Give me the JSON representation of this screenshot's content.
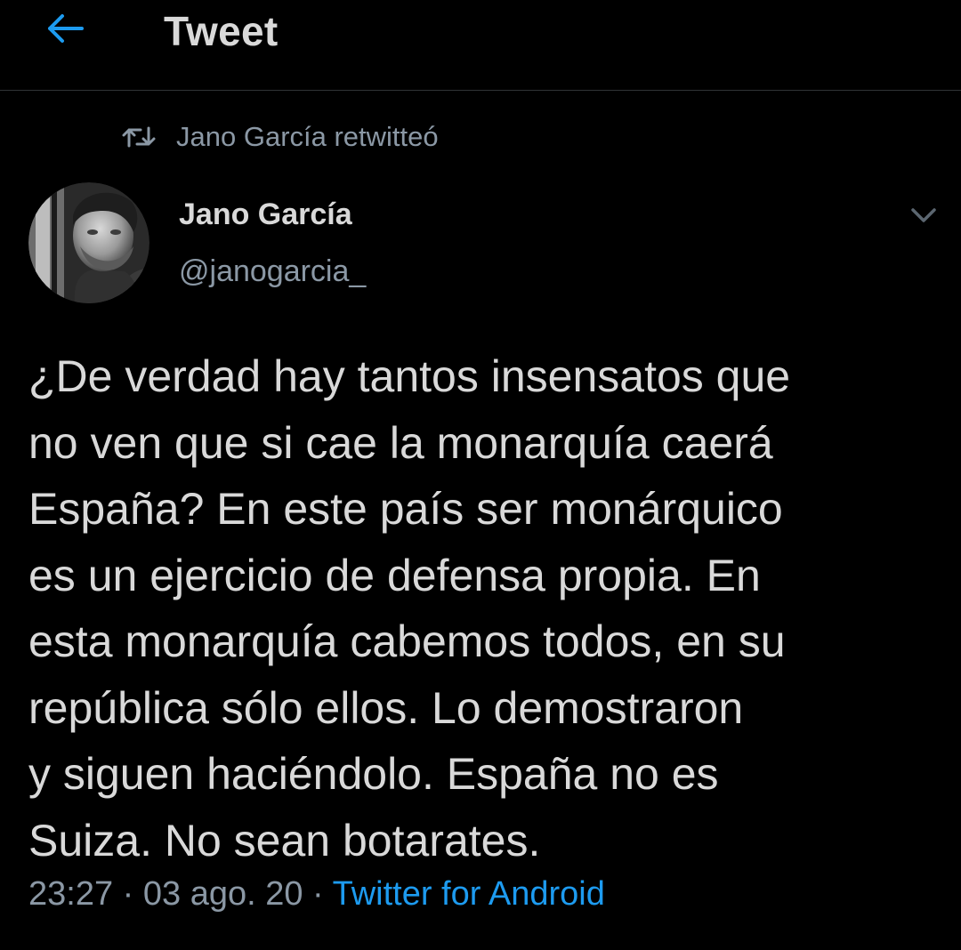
{
  "header": {
    "title": "Tweet",
    "back_icon": "arrow-left-icon",
    "accent_color": "#1d9bf0"
  },
  "retweet_context": {
    "icon": "retweet-icon",
    "text": "Jano García retwitteó"
  },
  "tweet": {
    "author_name": "Jano García",
    "author_handle": "@janogarcia_",
    "avatar": "avatar-photo",
    "more_icon": "chevron-down-icon",
    "text": "¿De verdad hay tantos insensatos que\nno ven que si cae la monarquía caerá\nEspaña? En este país ser monárquico\nes un ejercicio de defensa propia. En\nesta monarquía cabemos todos, en su\nrepública sólo ellos. Lo demostraron\ny siguen haciéndolo. España no es\nSuiza. No sean botarates.",
    "time": "23:27",
    "separator": "·",
    "date": "03 ago. 20",
    "source": "Twitter for Android"
  },
  "colors": {
    "background": "#000000",
    "primary_text": "#d9d9d9",
    "secondary_text": "#8b98a5",
    "link": "#1d9bf0"
  }
}
